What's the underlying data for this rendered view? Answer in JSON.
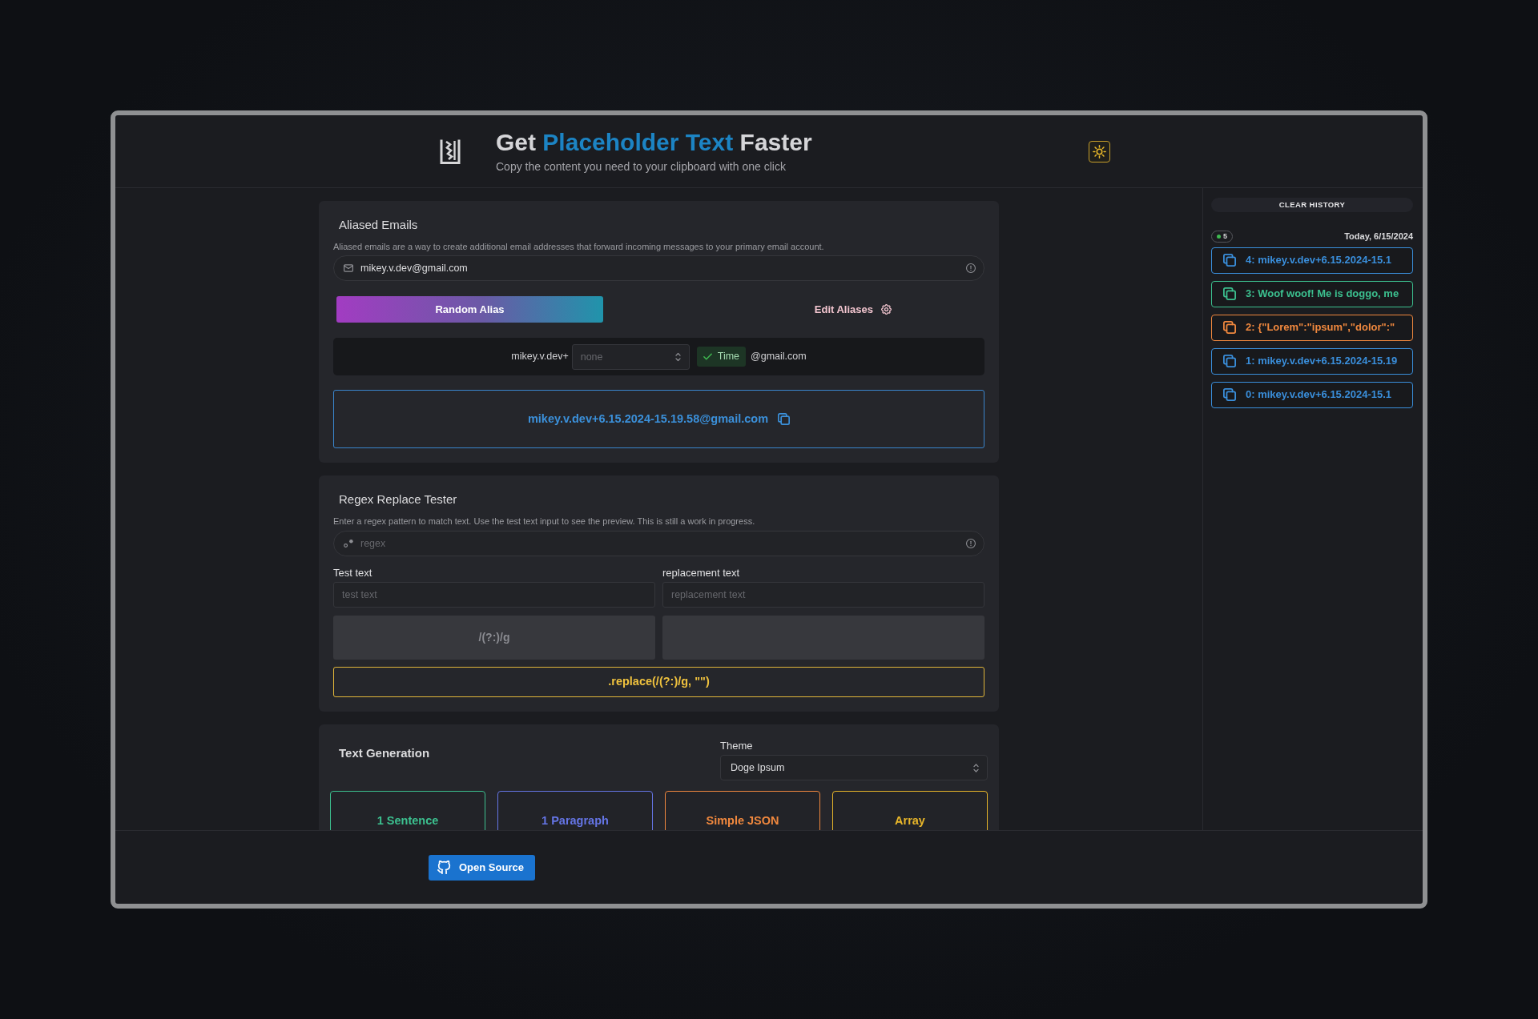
{
  "header": {
    "title": {
      "lead": "Get",
      "highlight": "Placeholder Text",
      "tail": "Faster"
    },
    "subtitle": "Copy the content you need to your clipboard with one click"
  },
  "aliased_emails": {
    "title": "Aliased Emails",
    "description": "Aliased emails are a way to create additional email addresses that forward incoming messages to your primary email account.",
    "email_field": {
      "value": "mikey.v.dev@gmail.com"
    },
    "random_button": "Random Alias",
    "edit_button": "Edit Aliases",
    "builder": {
      "prefix": "mikey.v.dev+",
      "tag_select": {
        "placeholder": "none"
      },
      "time_toggle": {
        "label": "Time",
        "checked": true
      },
      "suffix": "@gmail.com"
    },
    "result": "mikey.v.dev+6.15.2024-15.19.58@gmail.com"
  },
  "regex_tester": {
    "title": "Regex Replace Tester",
    "description": "Enter a regex pattern to match text. Use the test text input to see the preview. This is still a work in progress.",
    "regex_field": {
      "placeholder": "regex"
    },
    "test_text": {
      "label": "Test text",
      "placeholder": "test text"
    },
    "replacement_text": {
      "label": "replacement text",
      "placeholder": "replacement text"
    },
    "pattern_preview": "/(?:)/g",
    "replace_call": ".replace(/(?:)/g, \"\")"
  },
  "text_generation": {
    "title": "Text Generation",
    "theme": {
      "label": "Theme",
      "value": "Doge Ipsum"
    },
    "buttons": [
      {
        "label": "1 Sentence",
        "color": "#3cc08f"
      },
      {
        "label": "1 Paragraph",
        "color": "#6575e6"
      },
      {
        "label": "Simple JSON",
        "color": "#f0883e"
      },
      {
        "label": "Array",
        "color": "#e8b62a"
      }
    ]
  },
  "history": {
    "clear_button": "CLEAR HISTORY",
    "count": "5",
    "date": "Today, 6/15/2024",
    "items": [
      {
        "text": "4: mikey.v.dev+6.15.2024-15.1",
        "color": "#3a8fdc"
      },
      {
        "text": "3: Woof woof! Me is doggo, me",
        "color": "#3cc08f"
      },
      {
        "text": "2: {\"Lorem\":\"ipsum\",\"dolor\":\"",
        "color": "#f0883e"
      },
      {
        "text": "1: mikey.v.dev+6.15.2024-15.19",
        "color": "#3a8fdc"
      },
      {
        "text": "0: mikey.v.dev+6.15.2024-15.1",
        "color": "#3a8fdc"
      }
    ]
  },
  "footer": {
    "open_source_button": "Open Source"
  }
}
